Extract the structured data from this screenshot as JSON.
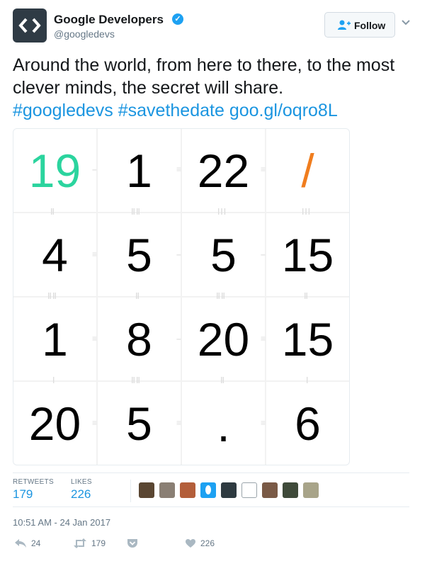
{
  "account": {
    "name": "Google Developers",
    "handle": "@googledevs",
    "verified": true
  },
  "follow_label": "Follow",
  "tweet": {
    "text": "Around the world, from here to there, to the most clever minds, the secret will share.",
    "hashtag1": "#googledevs",
    "hashtag2": "#savethedate",
    "link": "goo.gl/oqro8L"
  },
  "image": {
    "grid": [
      [
        "19",
        "1",
        "22",
        "/"
      ],
      [
        "4",
        "5",
        "5",
        "15"
      ],
      [
        "1",
        "8",
        "20",
        "15"
      ],
      [
        "20",
        "5",
        ".",
        "6"
      ]
    ],
    "accent_green": "#2bd49e",
    "accent_orange": "#f07d1e"
  },
  "stats": {
    "retweets_label": "RETWEETS",
    "retweets": "179",
    "likes_label": "LIKES",
    "likes": "226"
  },
  "timestamp": "10:51 AM - 24 Jan 2017",
  "actions": {
    "reply_count": "24",
    "retweet_count": "179",
    "like_count": "226"
  },
  "colors": {
    "link": "#1b95e0",
    "muted": "#657786",
    "verified": "#1da1f2"
  }
}
